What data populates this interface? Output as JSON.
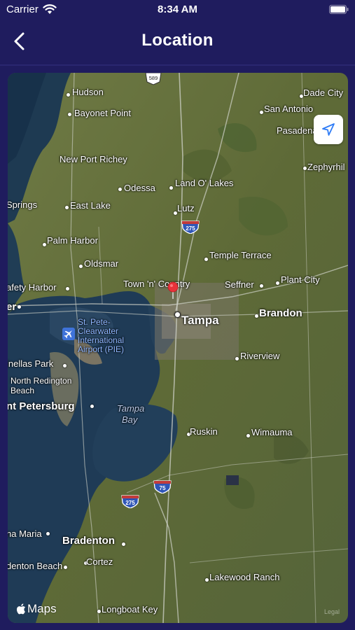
{
  "status_bar": {
    "carrier": "Carrier",
    "time": "8:34 AM"
  },
  "nav": {
    "title": "Location"
  },
  "map": {
    "attribution": "Maps",
    "legal": "Legal",
    "highway_shields": [
      "589",
      "275",
      "275",
      "75"
    ],
    "places": {
      "hudson": "Hudson",
      "bayonet_point": "Bayonet Point",
      "new_port_richey": "New Port Richey",
      "odessa": "Odessa",
      "land_o_lakes": "Land O' Lakes",
      "springs": "Springs",
      "east_lake": "East Lake",
      "lutz": "Lutz",
      "dade_city": "Dade City",
      "san_antonio": "San Antonio",
      "pasadena": "Pasadena",
      "zephyrhills": "Zephyrhil",
      "palm_harbor": "Palm Harbor",
      "temple_terrace": "Temple Terrace",
      "oldsmar": "Oldsmar",
      "safety_harbor": "afety Harbor",
      "town_n_country": "Town 'n' Country",
      "seffner": "Seffner",
      "plant_city": "Plant City",
      "er": "er",
      "tampa": "Tampa",
      "brandon": "Brandon",
      "airport": [
        "St. Pete-",
        "Clearwater",
        "International",
        "Airport (PIE)"
      ],
      "pinellas_park": "inellas Park",
      "riverview": "Riverview",
      "north_redington_beach": [
        "North Redington",
        "Beach"
      ],
      "st_petersburg": "nt Petersburg",
      "tampa_bay": [
        "Tampa",
        "Bay"
      ],
      "ruskin": "Ruskin",
      "wimauma": "Wimauma",
      "anna_maria": "na Maria",
      "bradenton": "Bradenton",
      "cortez": "Cortez",
      "bradenton_beach": "denton Beach",
      "lakewood_ranch": "Lakewood Ranch",
      "longboat_key": "Longboat Key"
    }
  }
}
